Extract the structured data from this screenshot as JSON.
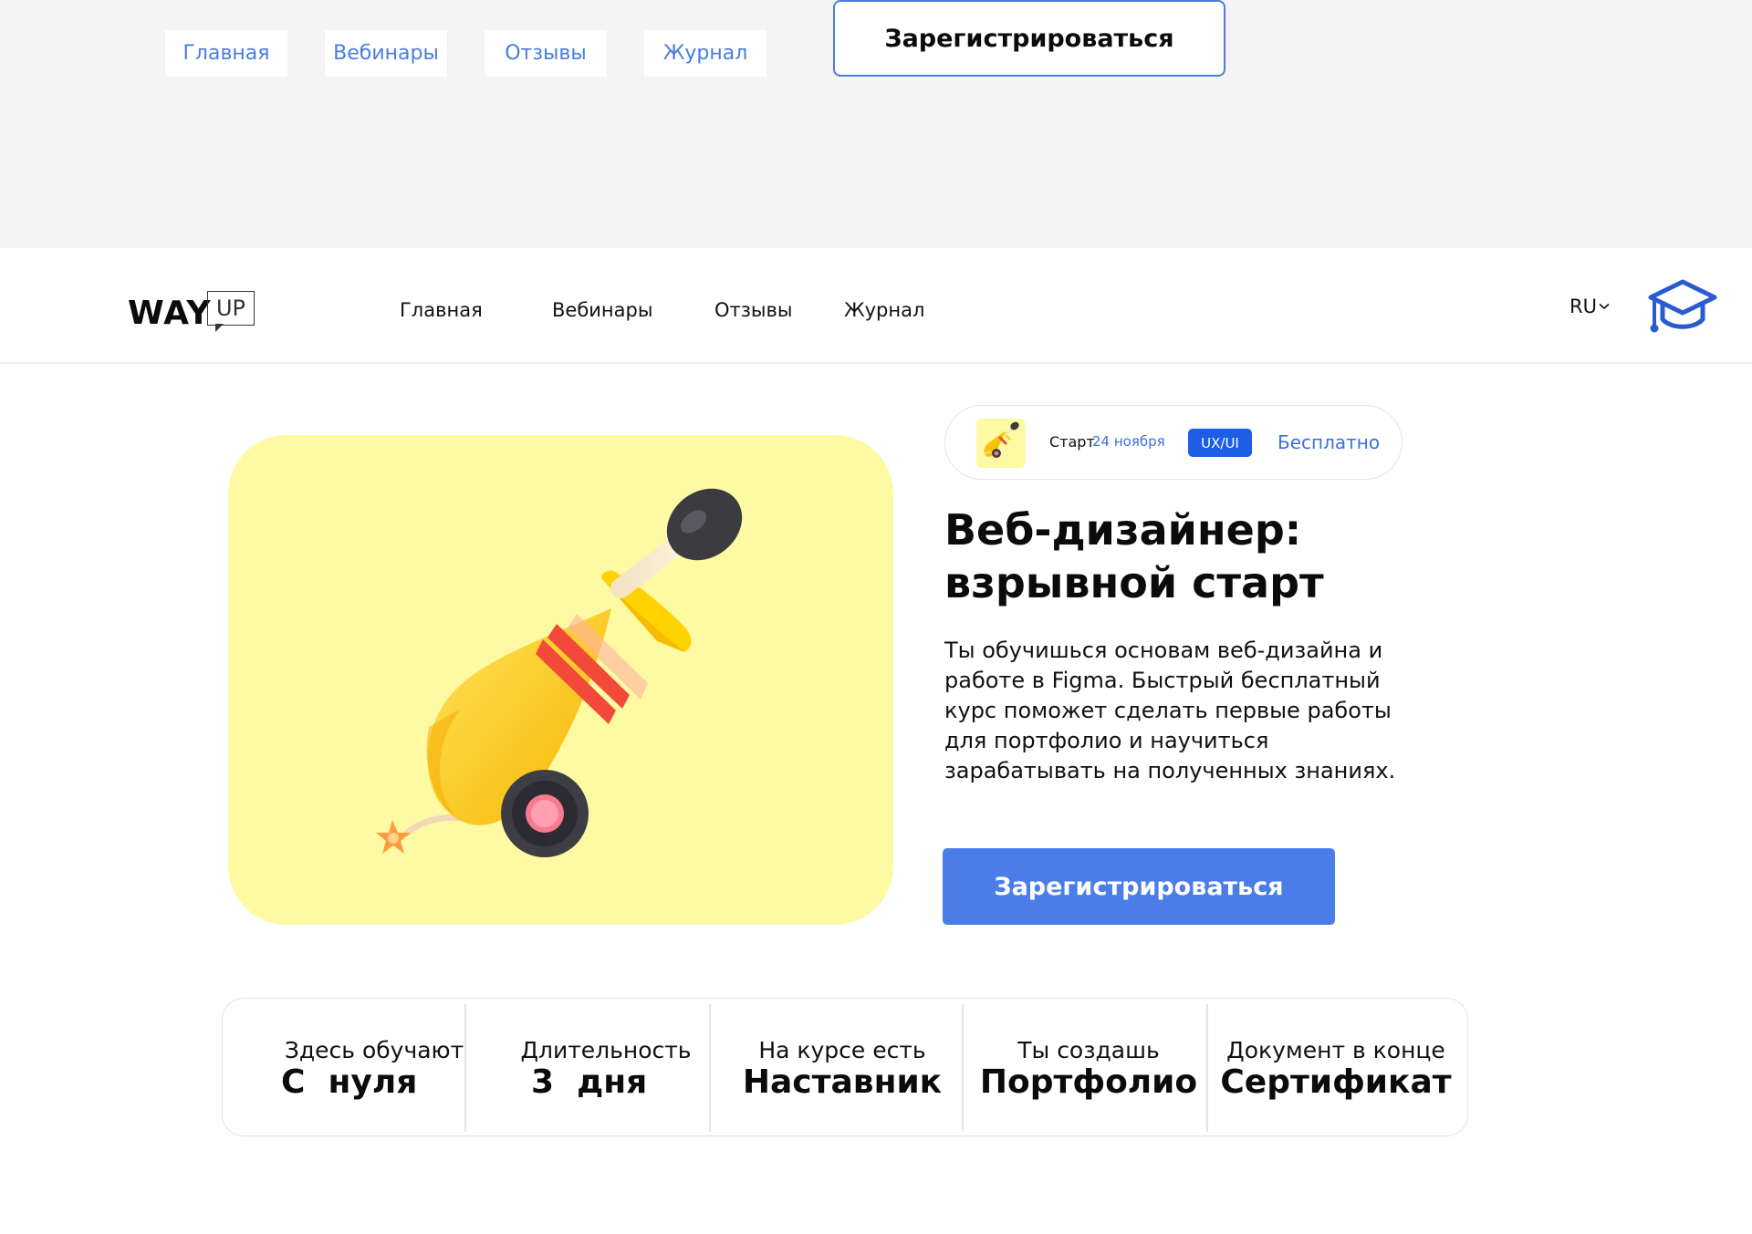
{
  "top_bar": {
    "links": [
      "Главная",
      "Вебинары",
      "Отзывы",
      "Журнал"
    ],
    "cta_label": "Зарегистрироваться"
  },
  "header": {
    "logo_word": "WAY",
    "logo_box": "UP",
    "nav": [
      "Главная",
      "Вебинары",
      "Отзывы",
      "Журнал"
    ],
    "language": "RU"
  },
  "course": {
    "start_label": "Старт",
    "start_date": "24 ноября",
    "tag": "UX/UI",
    "price": "Бесплатно",
    "title_line1": "Веб-дизайнер:",
    "title_line2": "взрывной старт",
    "description": "Ты обучишься основам веб-дизайна и работе в Figma. Быстрый бесплатный курс поможет сделать первые работы для портфолио и научиться зарабатывать на полученных знаниях.",
    "cta_label": "Зарегистрироваться"
  },
  "features": [
    {
      "label": "Здесь обучают",
      "value": "С  нуля"
    },
    {
      "label": "Длительность",
      "value": "3  дня"
    },
    {
      "label": "На курсе есть",
      "value": "Наставник"
    },
    {
      "label": "Ты создашь",
      "value": "Портфолио"
    },
    {
      "label": "Документ в конце",
      "value": "Сертификат"
    }
  ],
  "colors": {
    "accent": "#4a7de8",
    "link": "#4a7de0",
    "tag_bg": "#1e5de6",
    "hero_bg": "#fefaa4",
    "top_bg": "#f4f4f4"
  },
  "icons": [
    "graduation-cap-icon",
    "chevron-down-icon",
    "cannon-illustration"
  ]
}
